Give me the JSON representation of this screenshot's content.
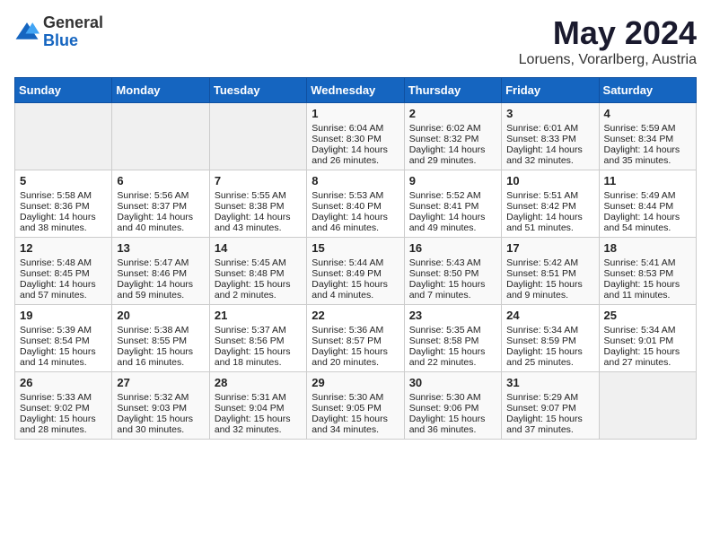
{
  "logo": {
    "general": "General",
    "blue": "Blue"
  },
  "title": {
    "month": "May 2024",
    "location": "Loruens, Vorarlberg, Austria"
  },
  "headers": [
    "Sunday",
    "Monday",
    "Tuesday",
    "Wednesday",
    "Thursday",
    "Friday",
    "Saturday"
  ],
  "weeks": [
    [
      {
        "day": "",
        "info": ""
      },
      {
        "day": "",
        "info": ""
      },
      {
        "day": "",
        "info": ""
      },
      {
        "day": "1",
        "info": "Sunrise: 6:04 AM\nSunset: 8:30 PM\nDaylight: 14 hours and 26 minutes."
      },
      {
        "day": "2",
        "info": "Sunrise: 6:02 AM\nSunset: 8:32 PM\nDaylight: 14 hours and 29 minutes."
      },
      {
        "day": "3",
        "info": "Sunrise: 6:01 AM\nSunset: 8:33 PM\nDaylight: 14 hours and 32 minutes."
      },
      {
        "day": "4",
        "info": "Sunrise: 5:59 AM\nSunset: 8:34 PM\nDaylight: 14 hours and 35 minutes."
      }
    ],
    [
      {
        "day": "5",
        "info": "Sunrise: 5:58 AM\nSunset: 8:36 PM\nDaylight: 14 hours and 38 minutes."
      },
      {
        "day": "6",
        "info": "Sunrise: 5:56 AM\nSunset: 8:37 PM\nDaylight: 14 hours and 40 minutes."
      },
      {
        "day": "7",
        "info": "Sunrise: 5:55 AM\nSunset: 8:38 PM\nDaylight: 14 hours and 43 minutes."
      },
      {
        "day": "8",
        "info": "Sunrise: 5:53 AM\nSunset: 8:40 PM\nDaylight: 14 hours and 46 minutes."
      },
      {
        "day": "9",
        "info": "Sunrise: 5:52 AM\nSunset: 8:41 PM\nDaylight: 14 hours and 49 minutes."
      },
      {
        "day": "10",
        "info": "Sunrise: 5:51 AM\nSunset: 8:42 PM\nDaylight: 14 hours and 51 minutes."
      },
      {
        "day": "11",
        "info": "Sunrise: 5:49 AM\nSunset: 8:44 PM\nDaylight: 14 hours and 54 minutes."
      }
    ],
    [
      {
        "day": "12",
        "info": "Sunrise: 5:48 AM\nSunset: 8:45 PM\nDaylight: 14 hours and 57 minutes."
      },
      {
        "day": "13",
        "info": "Sunrise: 5:47 AM\nSunset: 8:46 PM\nDaylight: 14 hours and 59 minutes."
      },
      {
        "day": "14",
        "info": "Sunrise: 5:45 AM\nSunset: 8:48 PM\nDaylight: 15 hours and 2 minutes."
      },
      {
        "day": "15",
        "info": "Sunrise: 5:44 AM\nSunset: 8:49 PM\nDaylight: 15 hours and 4 minutes."
      },
      {
        "day": "16",
        "info": "Sunrise: 5:43 AM\nSunset: 8:50 PM\nDaylight: 15 hours and 7 minutes."
      },
      {
        "day": "17",
        "info": "Sunrise: 5:42 AM\nSunset: 8:51 PM\nDaylight: 15 hours and 9 minutes."
      },
      {
        "day": "18",
        "info": "Sunrise: 5:41 AM\nSunset: 8:53 PM\nDaylight: 15 hours and 11 minutes."
      }
    ],
    [
      {
        "day": "19",
        "info": "Sunrise: 5:39 AM\nSunset: 8:54 PM\nDaylight: 15 hours and 14 minutes."
      },
      {
        "day": "20",
        "info": "Sunrise: 5:38 AM\nSunset: 8:55 PM\nDaylight: 15 hours and 16 minutes."
      },
      {
        "day": "21",
        "info": "Sunrise: 5:37 AM\nSunset: 8:56 PM\nDaylight: 15 hours and 18 minutes."
      },
      {
        "day": "22",
        "info": "Sunrise: 5:36 AM\nSunset: 8:57 PM\nDaylight: 15 hours and 20 minutes."
      },
      {
        "day": "23",
        "info": "Sunrise: 5:35 AM\nSunset: 8:58 PM\nDaylight: 15 hours and 22 minutes."
      },
      {
        "day": "24",
        "info": "Sunrise: 5:34 AM\nSunset: 8:59 PM\nDaylight: 15 hours and 25 minutes."
      },
      {
        "day": "25",
        "info": "Sunrise: 5:34 AM\nSunset: 9:01 PM\nDaylight: 15 hours and 27 minutes."
      }
    ],
    [
      {
        "day": "26",
        "info": "Sunrise: 5:33 AM\nSunset: 9:02 PM\nDaylight: 15 hours and 28 minutes."
      },
      {
        "day": "27",
        "info": "Sunrise: 5:32 AM\nSunset: 9:03 PM\nDaylight: 15 hours and 30 minutes."
      },
      {
        "day": "28",
        "info": "Sunrise: 5:31 AM\nSunset: 9:04 PM\nDaylight: 15 hours and 32 minutes."
      },
      {
        "day": "29",
        "info": "Sunrise: 5:30 AM\nSunset: 9:05 PM\nDaylight: 15 hours and 34 minutes."
      },
      {
        "day": "30",
        "info": "Sunrise: 5:30 AM\nSunset: 9:06 PM\nDaylight: 15 hours and 36 minutes."
      },
      {
        "day": "31",
        "info": "Sunrise: 5:29 AM\nSunset: 9:07 PM\nDaylight: 15 hours and 37 minutes."
      },
      {
        "day": "",
        "info": ""
      }
    ]
  ]
}
